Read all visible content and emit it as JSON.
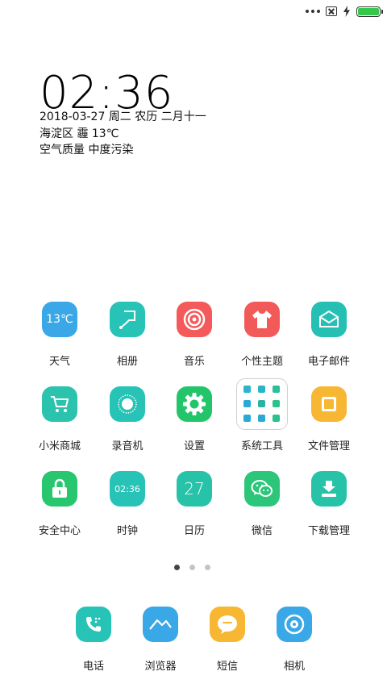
{
  "status": {
    "battery_level": 1.0,
    "colors": {
      "battery": "#35c84a"
    }
  },
  "lockwidget": {
    "time": "02:36",
    "date": "2018-03-27 周二 农历 二月十一",
    "weather": "海淀区 霾 13℃",
    "air": "空气质量 中度污染"
  },
  "apps": [
    {
      "label": "天气",
      "icon": "weather-icon",
      "color": "#3aa7e6",
      "tile_text": "13℃"
    },
    {
      "label": "相册",
      "icon": "gallery-icon",
      "color": "#26c3b6"
    },
    {
      "label": "音乐",
      "icon": "music-icon",
      "color": "#f45a5a"
    },
    {
      "label": "个性主题",
      "icon": "theme-icon",
      "color": "#f25a5a"
    },
    {
      "label": "电子邮件",
      "icon": "mail-icon",
      "color": "#26bfb3"
    },
    {
      "label": "小米商城",
      "icon": "cart-icon",
      "color": "#2bc3ae"
    },
    {
      "label": "录音机",
      "icon": "recorder-icon",
      "color": "#26c3b6"
    },
    {
      "label": "设置",
      "icon": "gear-icon",
      "color": "#23c56a"
    },
    {
      "label": "系统工具",
      "icon": "folder-icon"
    },
    {
      "label": "文件管理",
      "icon": "file-icon",
      "color": "#f7b733"
    },
    {
      "label": "安全中心",
      "icon": "lock-icon",
      "color": "#27c66f"
    },
    {
      "label": "时钟",
      "icon": "clock-icon",
      "color": "#26c3b6",
      "tile_text": "02:36"
    },
    {
      "label": "日历",
      "icon": "calendar-icon",
      "color": "#26c3a8",
      "tile_text": "27"
    },
    {
      "label": "微信",
      "icon": "wechat-icon",
      "color": "#2cc67a"
    },
    {
      "label": "下载管理",
      "icon": "download-icon",
      "color": "#26c3a8"
    }
  ],
  "dock": [
    {
      "label": "电话",
      "icon": "phone-icon",
      "color": "#26c3b6"
    },
    {
      "label": "浏览器",
      "icon": "browser-icon",
      "color": "#3aa7e6"
    },
    {
      "label": "短信",
      "icon": "message-icon",
      "color": "#f7b733"
    },
    {
      "label": "相机",
      "icon": "camera-icon",
      "color": "#3aa7e6"
    }
  ],
  "pager": {
    "pages": 3,
    "current": 1
  }
}
